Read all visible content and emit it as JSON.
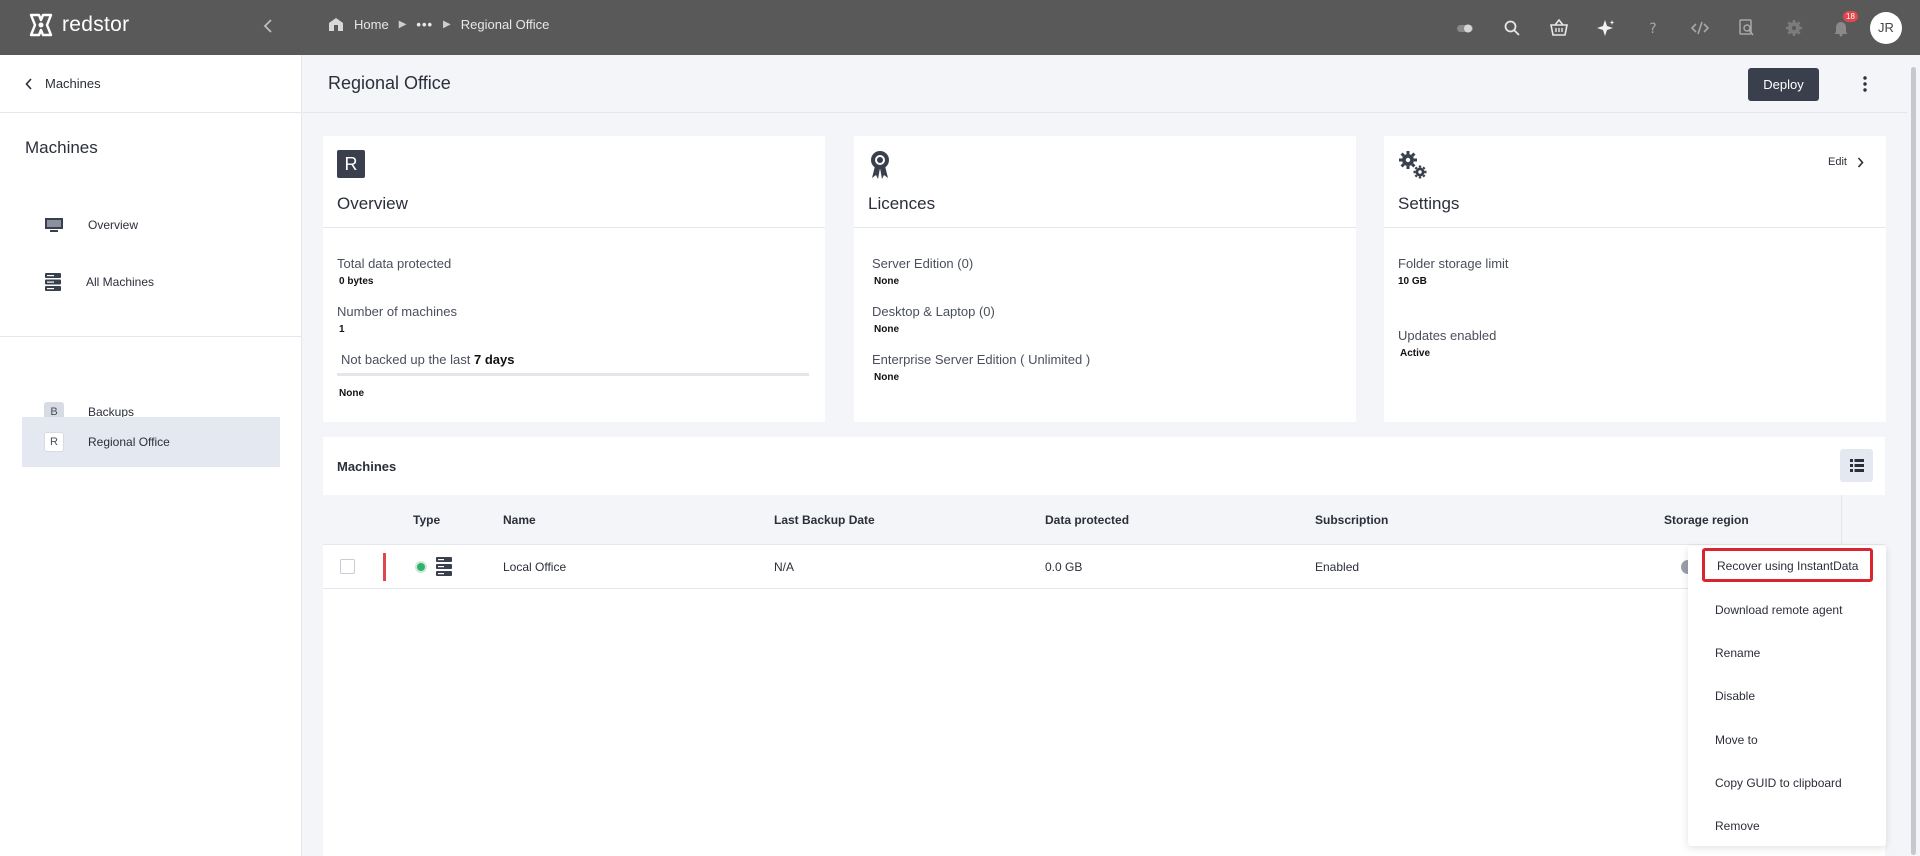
{
  "brand": {
    "name": "redstor"
  },
  "breadcrumb": {
    "home": "Home",
    "ellipsis": "•••",
    "current": "Regional Office"
  },
  "topbar": {
    "notification_count": "18",
    "avatar_initials": "JR",
    "icons": [
      "toggle-icon",
      "search-icon",
      "basket-icon",
      "sparkle-icon",
      "help-icon",
      "code-icon",
      "search-doc-icon",
      "gear-icon",
      "bell-icon"
    ]
  },
  "sidebar": {
    "back_label": "Machines",
    "title": "Machines",
    "items": [
      {
        "label": "Overview",
        "icon": "monitor-icon"
      },
      {
        "label": "All Machines",
        "icon": "server-icon"
      },
      {
        "label": "Backups",
        "letter": "B"
      },
      {
        "label": "Regional Office",
        "letter": "R"
      }
    ]
  },
  "page": {
    "title": "Regional Office",
    "deploy_label": "Deploy"
  },
  "overview": {
    "icon_letter": "R",
    "title": "Overview",
    "total_label": "Total data protected",
    "total_value": "0 bytes",
    "machines_label": "Number of machines",
    "machines_value": "1",
    "not_backed_prefix": "Not backed up the last",
    "not_backed_days": "7 days",
    "not_backed_value": "None"
  },
  "licences": {
    "title": "Licences",
    "items": [
      {
        "label": "Server Edition (0)",
        "value": "None"
      },
      {
        "label": "Desktop & Laptop (0)",
        "value": "None"
      },
      {
        "label": "Enterprise Server Edition ( Unlimited )",
        "value": "None"
      }
    ]
  },
  "settings": {
    "title": "Settings",
    "edit_label": "Edit",
    "folder_label": "Folder storage limit",
    "folder_value": "10 GB",
    "updates_label": "Updates enabled",
    "updates_value": "Active"
  },
  "machines": {
    "title": "Machines",
    "columns": [
      "Type",
      "Name",
      "Last Backup Date",
      "Data protected",
      "Subscription",
      "Storage region"
    ],
    "rows": [
      {
        "name": "Local Office",
        "last_backup": "N/A",
        "data_protected": "0.0 GB",
        "subscription": "Enabled"
      }
    ]
  },
  "context_menu": {
    "items": [
      "Recover using InstantData",
      "Download remote agent",
      "Rename",
      "Disable",
      "Move to",
      "Copy GUID to clipboard",
      "Remove"
    ]
  }
}
